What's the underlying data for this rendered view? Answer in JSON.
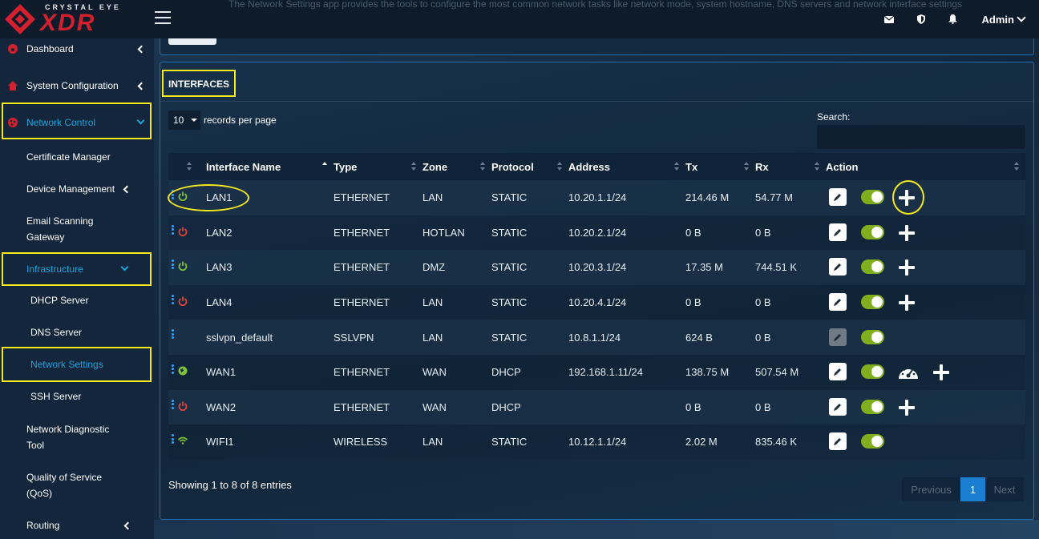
{
  "app": {
    "logo_small": "CRYSTAL EYE",
    "logo_big": "XDR",
    "description": "The Network Settings app provides the tools to configure the most common network tasks like network mode, system hostname, DNS servers and network interface settings",
    "user": "Admin",
    "colors": {
      "brand_red": "#d3202f",
      "accent_blue": "#19a3dd",
      "highlight_yellow": "#f5e81c",
      "toggle_green": "#7fae1f"
    }
  },
  "topbar_icons": [
    "mail-icon",
    "shield-icon",
    "bell-icon"
  ],
  "sidebar": {
    "dashboard": "Dashboard",
    "system_configuration": "System Configuration",
    "network_control": "Network Control",
    "certificate_manager": "Certificate Manager",
    "device_management": "Device Management",
    "email_scanning_1": "Email Scanning",
    "email_scanning_2": "Gateway",
    "infrastructure": "Infrastructure",
    "dhcp_server": "DHCP Server",
    "dns_server": "DNS Server",
    "network_settings": "Network Settings",
    "ssh_server": "SSH Server",
    "network_diagnostic_1": "Network Diagnostic",
    "network_diagnostic_2": "Tool",
    "qos_1": "Quality of Service",
    "qos_2": "(QoS)",
    "routing": "Routing"
  },
  "panel": {
    "title": "INTERFACES",
    "records_value": "10",
    "records_label": "records per page",
    "search_label": "Search:",
    "columns": [
      "Interface Name",
      "Type",
      "Zone",
      "Protocol",
      "Address",
      "Tx",
      "Rx",
      "Action"
    ],
    "rows": [
      {
        "status": "on",
        "name": "LAN1",
        "type": "ETHERNET",
        "zone": "LAN",
        "protocol": "STATIC",
        "address": "10.20.1.1/24",
        "tx": "214.46 M",
        "rx": "54.77 M"
      },
      {
        "status": "off",
        "name": "LAN2",
        "type": "ETHERNET",
        "zone": "HOTLAN",
        "protocol": "STATIC",
        "address": "10.20.2.1/24",
        "tx": "0 B",
        "rx": "0 B"
      },
      {
        "status": "on",
        "name": "LAN3",
        "type": "ETHERNET",
        "zone": "DMZ",
        "protocol": "STATIC",
        "address": "10.20.3.1/24",
        "tx": "17.35 M",
        "rx": "744.51 K"
      },
      {
        "status": "off",
        "name": "LAN4",
        "type": "ETHERNET",
        "zone": "LAN",
        "protocol": "STATIC",
        "address": "10.20.4.1/24",
        "tx": "0 B",
        "rx": "0 B"
      },
      {
        "status": "none",
        "name": "sslvpn_default",
        "type": "SSLVPN",
        "zone": "LAN",
        "protocol": "STATIC",
        "address": "10.8.1.1/24",
        "tx": "624 B",
        "rx": "0 B"
      },
      {
        "status": "globe",
        "name": "WAN1",
        "type": "ETHERNET",
        "zone": "WAN",
        "protocol": "DHCP",
        "address": "192.168.1.11/24",
        "tx": "138.75 M",
        "rx": "507.54 M"
      },
      {
        "status": "off",
        "name": "WAN2",
        "type": "ETHERNET",
        "zone": "WAN",
        "protocol": "DHCP",
        "address": "",
        "tx": "0 B",
        "rx": "0 B"
      },
      {
        "status": "wifi",
        "name": "WIFI1",
        "type": "WIRELESS",
        "zone": "LAN",
        "protocol": "STATIC",
        "address": "10.12.1.1/24",
        "tx": "2.02 M",
        "rx": "835.46 K"
      }
    ],
    "footer": "Showing 1 to 8 of 8 entries",
    "pager": {
      "prev": "Previous",
      "current": "1",
      "next": "Next"
    }
  }
}
